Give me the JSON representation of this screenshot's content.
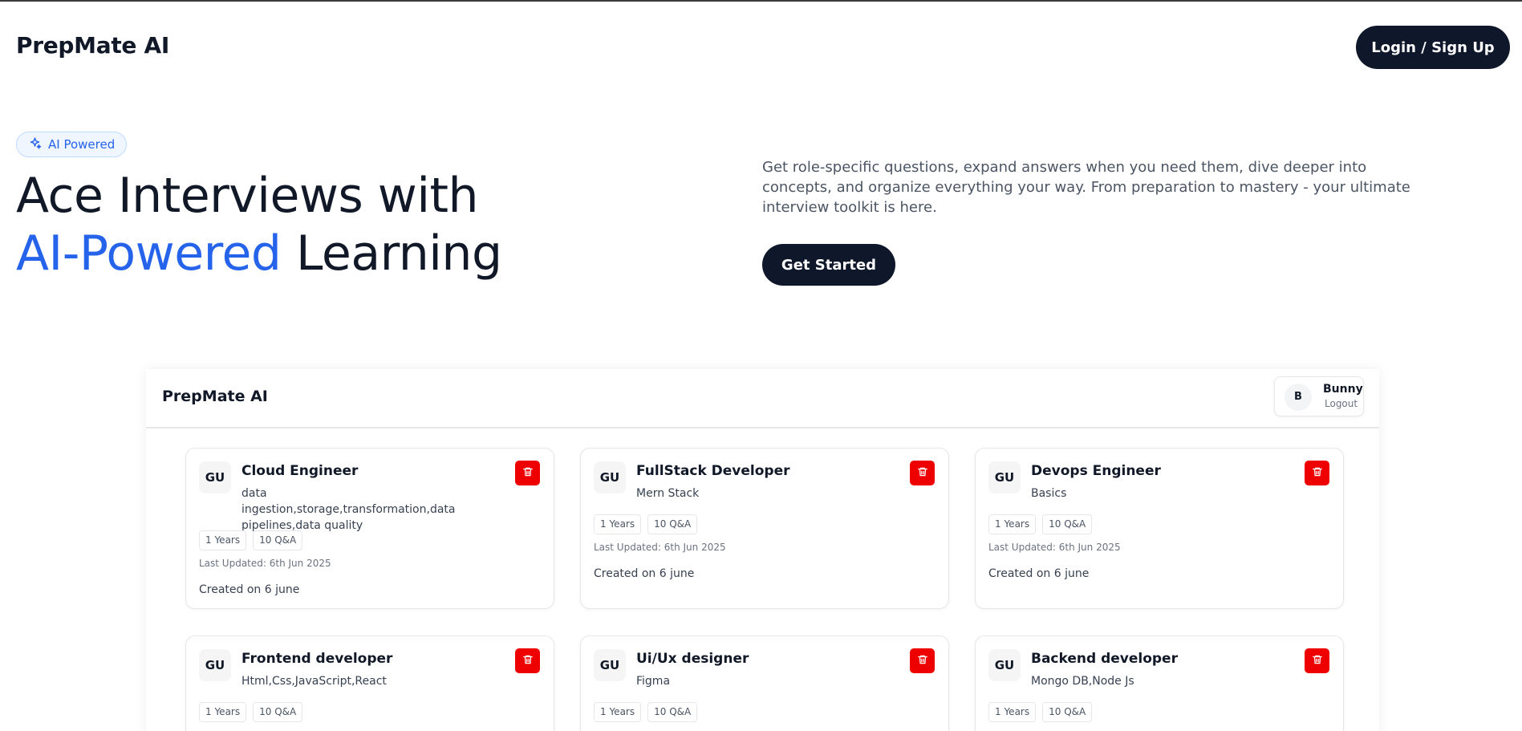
{
  "app": {
    "brand": "PrepMate AI",
    "login_label": "Login / Sign Up"
  },
  "hero": {
    "badge": "AI Powered",
    "title_line1": "Ace Interviews with",
    "title_accent": "AI-Powered",
    "title_rest": " Learning",
    "description": "Get role-specific questions, expand answers when you need them, dive deeper into concepts, and organize everything your way. From preparation to mastery - your ultimate interview toolkit is here.",
    "cta_label": "Get Started"
  },
  "preview": {
    "brand": "PrepMate AI",
    "user": {
      "initial": "B",
      "name": "Bunny",
      "logout": "Logout"
    },
    "cards": [
      {
        "initials": "GU",
        "title": "Cloud Engineer",
        "desc": "data ingestion,storage,transformation,data pipelines,data quality",
        "experience": "1 Years",
        "qa": "10 Q&A",
        "updated": "Last Updated: 6th Jun 2025",
        "created": "Created on 6 june"
      },
      {
        "initials": "GU",
        "title": "FullStack Developer",
        "desc": "Mern Stack",
        "experience": "1 Years",
        "qa": "10 Q&A",
        "updated": "Last Updated: 6th Jun 2025",
        "created": "Created on 6 june"
      },
      {
        "initials": "GU",
        "title": "Devops Engineer",
        "desc": "Basics",
        "experience": "1 Years",
        "qa": "10 Q&A",
        "updated": "Last Updated: 6th Jun 2025",
        "created": "Created on 6 june"
      },
      {
        "initials": "GU",
        "title": "Frontend developer",
        "desc": "Html,Css,JavaScript,React",
        "experience": "1 Years",
        "qa": "10 Q&A"
      },
      {
        "initials": "GU",
        "title": "Ui/Ux designer",
        "desc": "Figma",
        "experience": "1 Years",
        "qa": "10 Q&A"
      },
      {
        "initials": "GU",
        "title": "Backend developer",
        "desc": "Mongo DB,Node Js",
        "experience": "1 Years",
        "qa": "10 Q&A"
      }
    ]
  },
  "colors": {
    "accent": "#2563eb",
    "dark": "#0f172a",
    "danger": "#ef0000"
  },
  "icons": {
    "badge": "sparkle-icon",
    "delete": "trash-icon"
  }
}
